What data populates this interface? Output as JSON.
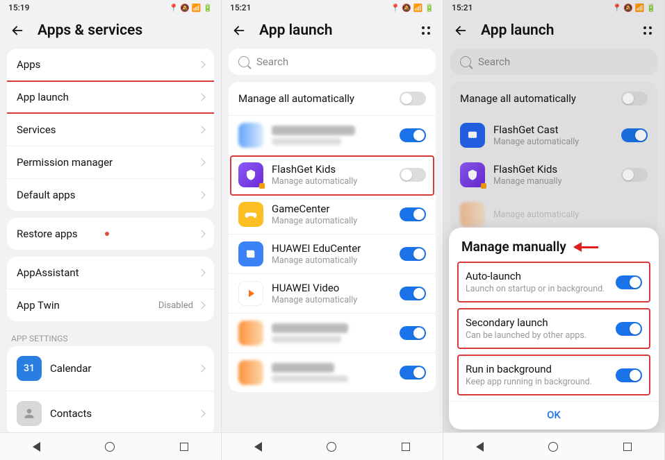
{
  "screen1": {
    "time": "15:19",
    "title": "Apps & services",
    "group1": [
      "Apps",
      "App launch",
      "Services",
      "Permission manager",
      "Default apps"
    ],
    "restore": "Restore apps",
    "group2": [
      {
        "label": "AppAssistant"
      },
      {
        "label": "App Twin",
        "sub": "Disabled"
      }
    ],
    "section": "APP SETTINGS",
    "apps": [
      {
        "label": "Calendar",
        "iconText": "31"
      },
      {
        "label": "Contacts"
      }
    ]
  },
  "screen2": {
    "time": "15:21",
    "title": "App launch",
    "search": "Search",
    "manageAll": "Manage all automatically",
    "sub": "Manage automatically",
    "apps": [
      {
        "name": "",
        "blur": true,
        "on": true
      },
      {
        "name": "FlashGet Kids",
        "on": false,
        "hl": true
      },
      {
        "name": "GameCenter",
        "on": true
      },
      {
        "name": "HUAWEI EduCenter",
        "on": true
      },
      {
        "name": "HUAWEI Video",
        "on": true
      },
      {
        "name": "",
        "blur": true,
        "on": true
      },
      {
        "name": "",
        "blur": true,
        "on": true
      }
    ]
  },
  "screen3": {
    "time": "15:21",
    "title": "App launch",
    "search": "Search",
    "manageAll": "Manage all automatically",
    "apps": [
      {
        "name": "FlashGet Cast",
        "sub": "Manage automatically",
        "on": true
      },
      {
        "name": "FlashGet Kids",
        "sub": "Manage manually",
        "on": false
      }
    ],
    "bgSub": "Manage automatically",
    "modal": {
      "title": "Manage manually",
      "opts": [
        {
          "t": "Auto-launch",
          "d": "Launch on startup or in background."
        },
        {
          "t": "Secondary launch",
          "d": "Can be launched by other apps."
        },
        {
          "t": "Run in background",
          "d": "Keep app running in background."
        }
      ],
      "ok": "OK"
    }
  }
}
